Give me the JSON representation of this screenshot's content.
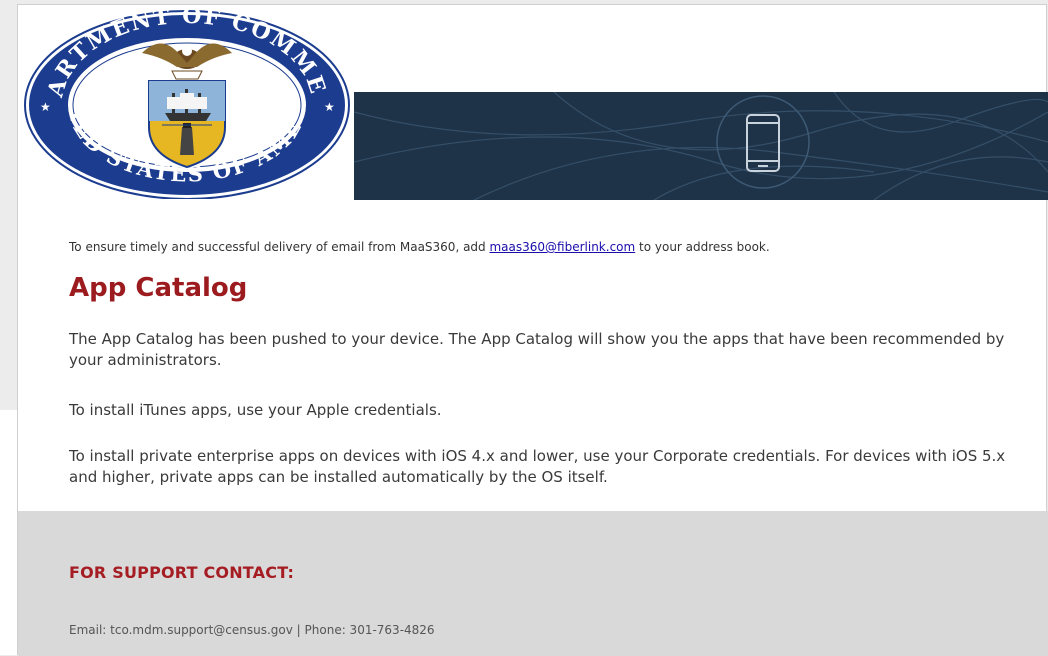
{
  "header": {
    "seal": {
      "icon": "department-of-commerce-seal-icon",
      "ring_text": "DEPARTMENT OF COMMERCE · UNITED STATES OF AMERICA"
    },
    "banner_icon": "smartphone-icon"
  },
  "notice": {
    "prefix": "To ensure timely and successful delivery of email from MaaS360, add ",
    "link": "maas360@fiberlink.com",
    "suffix": " to your address book."
  },
  "content": {
    "title": "App Catalog",
    "paragraphs": [
      "The App Catalog has been pushed to your device. The App Catalog will show you the apps that have been recommended by your administrators.",
      "To install iTunes apps, use your Apple credentials.",
      "To install private enterprise apps on devices with iOS 4.x and lower, use your Corporate credentials. For devices with iOS 5.x and higher, private apps can be installed automatically by the OS itself."
    ]
  },
  "footer": {
    "heading": "FOR SUPPORT CONTACT:",
    "contact": "Email: tco.mdm.support@census.gov | Phone: 301-763-4826"
  },
  "colors": {
    "title": "#9b1b1f",
    "banner": "#1e3348",
    "footer_bg": "#d9d9d9",
    "link": "#1a0dab"
  }
}
